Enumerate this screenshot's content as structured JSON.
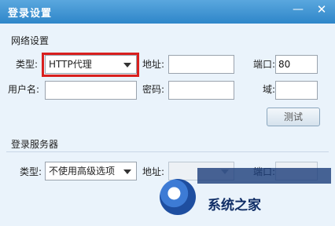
{
  "window": {
    "title": "登录设置",
    "minimize_icon": "minimize-icon",
    "close_icon": "close-icon",
    "minimize_symbol": "—",
    "close_symbol": "✕"
  },
  "network": {
    "section_title": "网络设置",
    "type_label": "类型:",
    "type_value": "HTTP代理",
    "address_label": "地址:",
    "address_value": "",
    "port_label": "端口:",
    "port_value": "80",
    "username_label": "用户名:",
    "username_value": "",
    "password_label": "密码:",
    "password_value": "",
    "domain_label": "域:",
    "domain_value": "",
    "test_button": "测试"
  },
  "login_server": {
    "section_title": "登录服务器",
    "type_label": "类型:",
    "type_value": "不使用高级选项",
    "address_label": "地址:",
    "address_value": "",
    "port_label": "端口:",
    "port_value": ""
  },
  "watermark": {
    "text": "系统之家"
  },
  "colors": {
    "titlebar": "#2e86c9",
    "highlight": "#d9201e",
    "panel": "#eaf3fb"
  }
}
